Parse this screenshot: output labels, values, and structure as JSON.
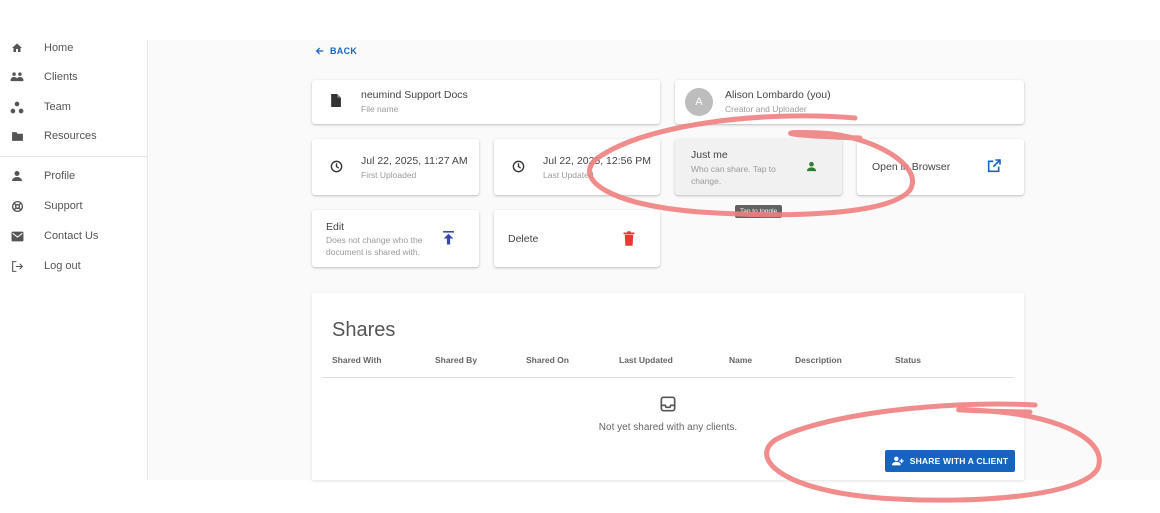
{
  "sidebar": {
    "items": [
      {
        "label": "Home",
        "icon": "home-icon"
      },
      {
        "label": "Clients",
        "icon": "group-icon"
      },
      {
        "label": "Team",
        "icon": "team-icon"
      },
      {
        "label": "Resources",
        "icon": "folder-icon"
      },
      {
        "label": "Profile",
        "icon": "person-icon"
      },
      {
        "label": "Support",
        "icon": "lifebuoy-icon"
      },
      {
        "label": "Contact Us",
        "icon": "mail-icon"
      },
      {
        "label": "Log out",
        "icon": "logout-icon"
      }
    ]
  },
  "back_label": "BACK",
  "file": {
    "name": "neumind Support Docs",
    "caption": "File name"
  },
  "creator": {
    "initial": "A",
    "name": "Alison Lombardo (you)",
    "caption": "Creator and Uploader"
  },
  "first_uploaded": {
    "date": "Jul 22, 2025, 11:27 AM",
    "caption": "First Uploaded"
  },
  "last_updated": {
    "date": "Jul 22, 2025, 12:56 PM",
    "caption": "Last Updated"
  },
  "sharing": {
    "title": "Just me",
    "caption": "Who can share. Tap to change.",
    "tooltip": "Tap to toggle",
    "icon_color": "#2e7d32"
  },
  "open_browser": {
    "label": "Open in Browser"
  },
  "edit": {
    "title": "Edit",
    "caption": "Does not change who the document is shared with.",
    "icon_color": "#3949ab"
  },
  "delete": {
    "label": "Delete",
    "icon_color": "#e53935"
  },
  "shares": {
    "title": "Shares",
    "columns": [
      "Shared With",
      "Shared By",
      "Shared On",
      "Last Updated",
      "Name",
      "Description",
      "Status"
    ],
    "empty_text": "Not yet shared with any clients.",
    "share_button": "SHARE WITH A CLIENT"
  },
  "colors": {
    "accent": "#1565c0",
    "annotation": "#f08080"
  }
}
